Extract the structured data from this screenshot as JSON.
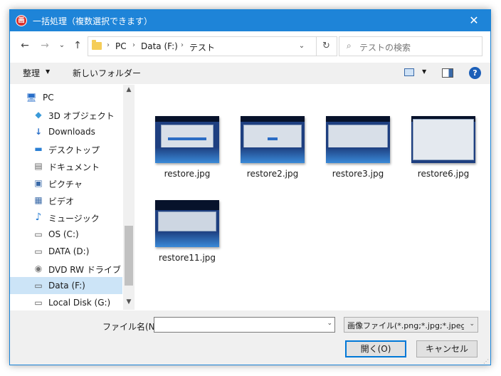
{
  "window": {
    "title": "一括処理（複数選択できます）",
    "app_icon": "画",
    "close": "✕"
  },
  "nav": {
    "back": "←",
    "forward": "→",
    "recent": "⌄",
    "up": "↑",
    "breadcrumb": [
      "PC",
      "Data (F:)",
      "テスト"
    ],
    "separator": "›",
    "dropdown": "⌄",
    "refresh": "↻",
    "search_icon": "⌕",
    "search_placeholder": "テストの検索"
  },
  "toolbar": {
    "organize": "整理",
    "organize_dd": "▼",
    "new_folder": "新しいフォルダー",
    "view_dd": "▼",
    "help": "?"
  },
  "sidebar": {
    "items": [
      {
        "label": "PC",
        "icon": "computer-icon",
        "glyph": "🖥"
      },
      {
        "label": "3D オブジェクト",
        "icon": "3d-objects-icon",
        "glyph": "◆"
      },
      {
        "label": "Downloads",
        "icon": "download-arrow-icon",
        "glyph": "↓"
      },
      {
        "label": "デスクトップ",
        "icon": "desktop-icon",
        "glyph": "▬"
      },
      {
        "label": "ドキュメント",
        "icon": "document-icon",
        "glyph": "▤"
      },
      {
        "label": "ピクチャ",
        "icon": "pictures-icon",
        "glyph": "▣"
      },
      {
        "label": "ビデオ",
        "icon": "video-icon",
        "glyph": "▦"
      },
      {
        "label": "ミュージック",
        "icon": "music-icon",
        "glyph": "♪"
      },
      {
        "label": "OS (C:)",
        "icon": "os-drive-icon",
        "glyph": "▭"
      },
      {
        "label": "DATA (D:)",
        "icon": "drive-icon",
        "glyph": "▭"
      },
      {
        "label": "DVD RW ドライブ (E:) .",
        "icon": "dvd-drive-icon",
        "glyph": "◉"
      },
      {
        "label": "Data (F:)",
        "icon": "drive-icon",
        "glyph": "▭",
        "selected": true
      },
      {
        "label": "Local Disk (G:)",
        "icon": "drive-icon",
        "glyph": "▭"
      }
    ],
    "scroll_up": "▲",
    "scroll_down": "▼"
  },
  "files": [
    {
      "name": "restore.jpg"
    },
    {
      "name": "restore2.jpg"
    },
    {
      "name": "restore3.jpg"
    },
    {
      "name": "restore6.jpg"
    },
    {
      "name": "restore11.jpg"
    }
  ],
  "bottom": {
    "filename_label": "ファイル名(N):",
    "filename_value": "",
    "filename_dd": "⌄",
    "filter": "画像ファイル(*.png;*.jpg;*.jpeg;*.",
    "filter_dd": "⌄",
    "open": "開く(O)",
    "cancel": "キャンセル",
    "grip": "⋰"
  }
}
